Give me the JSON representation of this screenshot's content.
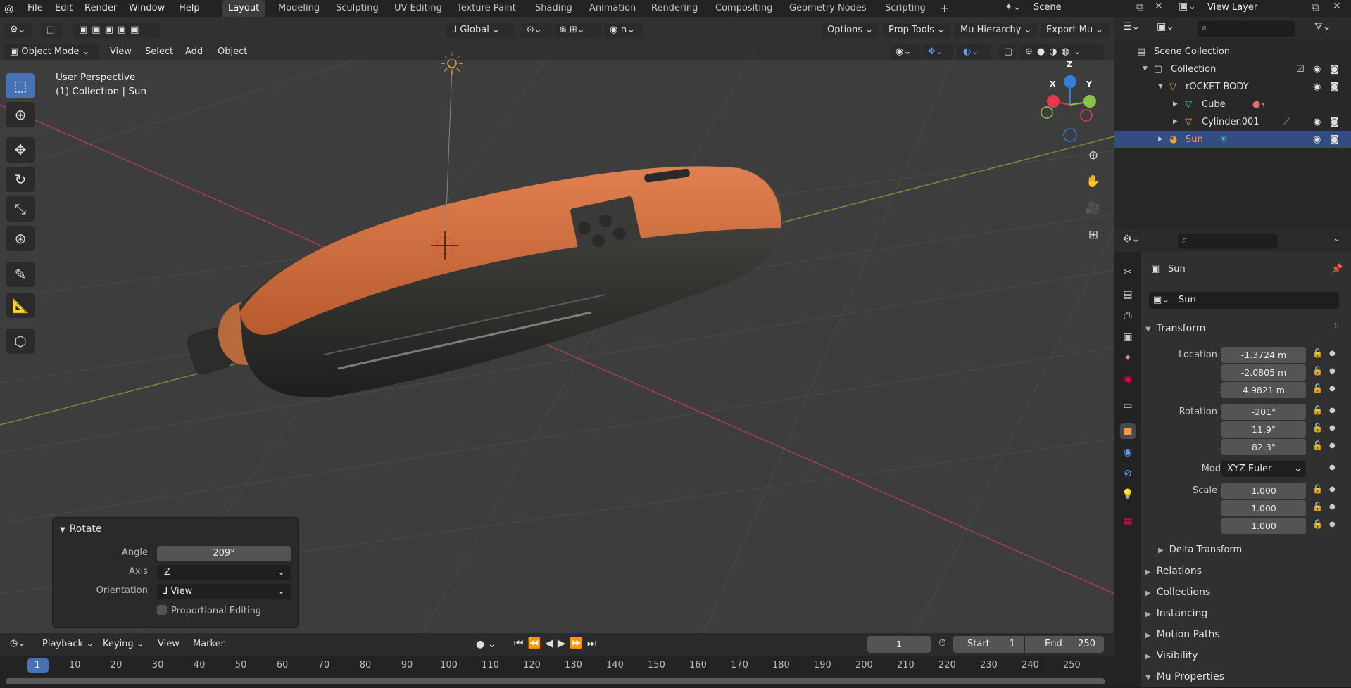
{
  "topbar": {
    "menus": [
      "File",
      "Edit",
      "Render",
      "Window",
      "Help"
    ],
    "workspaces": [
      "Layout",
      "Modeling",
      "Sculpting",
      "UV Editing",
      "Texture Paint",
      "Shading",
      "Animation",
      "Rendering",
      "Compositing",
      "Geometry Nodes",
      "Scripting"
    ],
    "active_workspace": "Layout",
    "add_tab": "+",
    "scene": "Scene",
    "view_layer": "View Layer"
  },
  "viewport_header": {
    "transform_orientation": "Global",
    "options": "Options",
    "prop_tools": "Prop Tools",
    "mu_hierarchy": "Mu Hierarchy",
    "export_mu": "Export Mu",
    "mode": "Object Mode",
    "menus": [
      "View",
      "Select",
      "Add",
      "Object"
    ]
  },
  "viewport": {
    "perspective": "User Perspective",
    "context": "(1) Collection | Sun",
    "gizmo": {
      "x": "X",
      "y": "Y",
      "z": "Z"
    }
  },
  "rotate_panel": {
    "title": "Rotate",
    "angle_label": "Angle",
    "angle": "209°",
    "axis_label": "Axis",
    "axis": "Z",
    "orientation_label": "Orientation",
    "orientation": "View",
    "proportional": "Proportional Editing"
  },
  "timeline": {
    "menus": [
      "Playback",
      "Keying",
      "View",
      "Marker"
    ],
    "current_frame": "1",
    "start_label": "Start",
    "start": "1",
    "end_label": "End",
    "end": "250",
    "ticks": [
      "1",
      "10",
      "20",
      "30",
      "40",
      "50",
      "60",
      "70",
      "80",
      "90",
      "100",
      "110",
      "120",
      "130",
      "140",
      "150",
      "160",
      "170",
      "180",
      "190",
      "200",
      "210",
      "220",
      "230",
      "240",
      "250"
    ]
  },
  "outliner": {
    "scene_collection": "Scene Collection",
    "items": [
      {
        "name": "Collection"
      },
      {
        "name": "rOCKET BODY"
      },
      {
        "name": "Cube"
      },
      {
        "name": "Cylinder.001"
      },
      {
        "name": "Sun"
      }
    ],
    "cube_badge": "3"
  },
  "properties": {
    "object_name_header": "Sun",
    "object_name_field": "Sun",
    "transform_title": "Transform",
    "location": {
      "label": "Location X",
      "x": "-1.3724 m",
      "y": "-2.0805 m",
      "z": "4.9821 m"
    },
    "rotation": {
      "label": "Rotation X",
      "x": "-201°",
      "y": "11.9°",
      "z": "82.3°"
    },
    "mode_label": "Mode",
    "mode": "XYZ Euler",
    "scale": {
      "label": "Scale X",
      "x": "1.000",
      "y": "1.000",
      "z": "1.000"
    },
    "axis_y": "Y",
    "axis_z": "Z",
    "sections": [
      "Delta Transform",
      "Relations",
      "Collections",
      "Instancing",
      "Motion Paths",
      "Visibility",
      "Mu Properties"
    ]
  },
  "colors": {
    "accent": "#4772b3",
    "selected_row": "#334d80",
    "x_axis": "#e8384f",
    "y_axis": "#8bc34a",
    "z_axis": "#2f81d8"
  }
}
